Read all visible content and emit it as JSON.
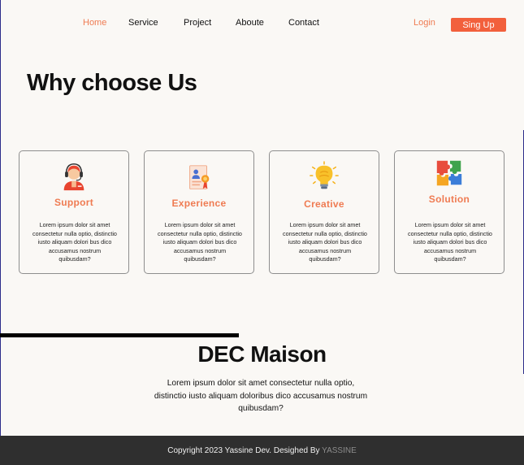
{
  "nav": {
    "home": "Home",
    "service": "Service",
    "project": "Project",
    "about": "Aboute",
    "contact": "Contact",
    "login": "Login",
    "signup": "Sing Up"
  },
  "section_title": "Why choose Us",
  "cards": [
    {
      "title": "Support",
      "icon": "headset-person-icon",
      "text": "Lorem ipsum dolor sit amet consectetur  nulla optio, distinctio iusto aliquam dolori bus dico accusamus nostrum quibusdam?"
    },
    {
      "title": "Experience",
      "icon": "certificate-icon",
      "text": "Lorem ipsum dolor sit amet consectetur  nulla optio, distinctio iusto aliquam dolori bus dico accusamus nostrum quibusdam?"
    },
    {
      "title": "Creative",
      "icon": "lightbulb-icon",
      "text": "Lorem ipsum dolor sit amet consectetur  nulla optio, distinctio iusto aliquam dolori bus dico accusamus nostrum quibusdam?"
    },
    {
      "title": "Solution",
      "icon": "puzzle-icon",
      "text": "Lorem ipsum dolor sit amet consectetur  nulla optio, distinctio iusto aliquam dolori bus dico accusamus nostrum quibusdam?"
    }
  ],
  "about": {
    "title": "DEC Maison",
    "text": "Lorem ipsum dolor sit amet consectetur  nulla optio, distinctio iusto aliquam doloribus dico accusamus nostrum quibusdam?"
  },
  "footer": {
    "copyright": "Copyright 2023 Yassine Dev. Desighed By ",
    "brand": "YASSINE"
  },
  "colors": {
    "accent": "#ef7b52",
    "button": "#f2603c",
    "background": "#faf8f5",
    "footer": "#2f2f2f"
  }
}
